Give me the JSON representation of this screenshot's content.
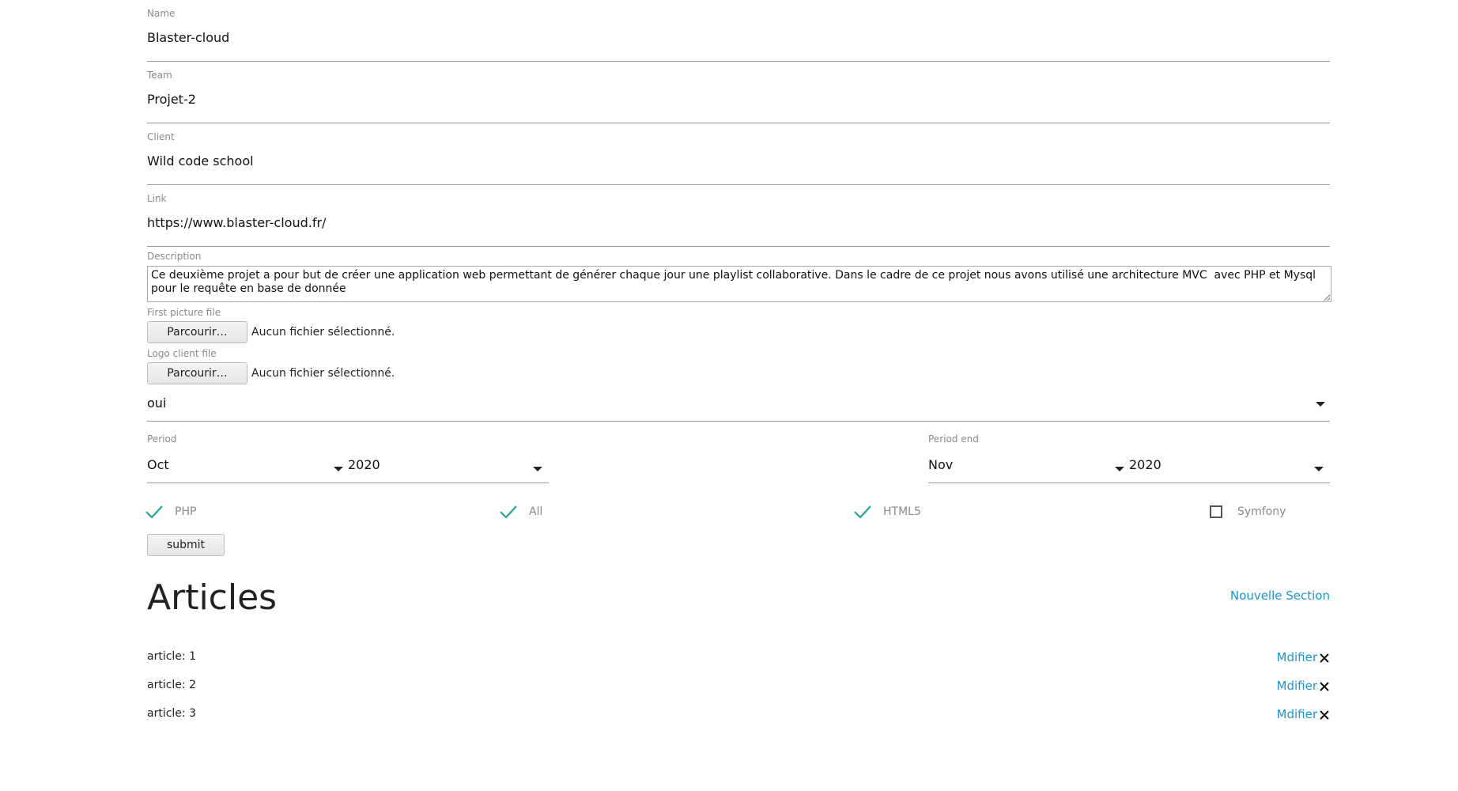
{
  "form": {
    "fields": [
      {
        "label": "Name",
        "value": "Blaster-cloud"
      },
      {
        "label": "Team",
        "value": "Projet-2"
      },
      {
        "label": "Client",
        "value": "Wild code school"
      },
      {
        "label": "Link",
        "value": "https://www.blaster-cloud.fr/"
      }
    ],
    "description": {
      "label": "Description",
      "value": "Ce deuxième projet a pour but de créer une application web permettant de générer chaque jour une playlist collaborative. Dans le cadre de ce projet nous avons utilisé une architecture MVC  avec PHP et Mysql pour le requête en base de donnée"
    },
    "first_picture": {
      "label": "First picture file",
      "button": "Parcourir…",
      "status": "Aucun fichier sélectionné."
    },
    "logo_client": {
      "label": "Logo client file",
      "button": "Parcourir…",
      "status": "Aucun fichier sélectionné."
    },
    "select_value": "oui",
    "period": {
      "label": "Period",
      "month": "Oct",
      "year": "2020"
    },
    "period_end": {
      "label": "Period end",
      "month": "Nov",
      "year": "2020"
    },
    "checkboxes": [
      {
        "label": "PHP",
        "checked": true
      },
      {
        "label": "All",
        "checked": true
      },
      {
        "label": "HTML5",
        "checked": true
      },
      {
        "label": "Symfony",
        "checked": false
      }
    ],
    "submit_label": "submit"
  },
  "articles": {
    "title": "Articles",
    "new_section": "Nouvelle Section",
    "edit_label": "Mdifier",
    "items": [
      {
        "name": "article: 1"
      },
      {
        "name": "article: 2"
      },
      {
        "name": "article: 3"
      }
    ]
  },
  "colors": {
    "accent": "#1a95d0",
    "check": "#26a69a"
  }
}
